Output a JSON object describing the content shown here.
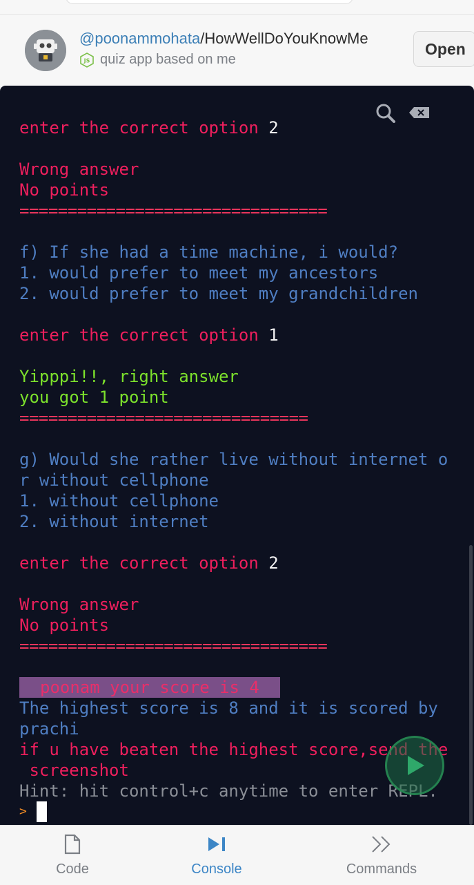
{
  "repl": {
    "owner": "@poonammohata",
    "separator": "/",
    "name": "HowWellDoYouKnowMe",
    "description": "quiz app based on me",
    "language_icon": "nodejs-icon",
    "open_label": "Open"
  },
  "console": {
    "lines": [
      {
        "parts": [
          {
            "t": "enter the correct option ",
            "c": "red"
          },
          {
            "t": "2",
            "c": "white"
          }
        ]
      },
      {
        "parts": []
      },
      {
        "parts": [
          {
            "t": "Wrong answer",
            "c": "red"
          }
        ]
      },
      {
        "parts": [
          {
            "t": "No points",
            "c": "red"
          }
        ]
      },
      {
        "parts": [
          {
            "t": "================================",
            "c": "sep"
          }
        ]
      },
      {
        "parts": []
      },
      {
        "parts": [
          {
            "t": "f) If she had a time machine, i would?",
            "c": "blue"
          }
        ]
      },
      {
        "parts": [
          {
            "t": "1. would prefer to meet my ancestors",
            "c": "blue"
          }
        ]
      },
      {
        "parts": [
          {
            "t": "2. would prefer to meet my grandchildren",
            "c": "blue"
          }
        ]
      },
      {
        "parts": []
      },
      {
        "parts": [
          {
            "t": "enter the correct option ",
            "c": "red"
          },
          {
            "t": "1",
            "c": "white"
          }
        ]
      },
      {
        "parts": []
      },
      {
        "parts": [
          {
            "t": "Yipppi!!, right answer",
            "c": "green"
          }
        ]
      },
      {
        "parts": [
          {
            "t": "you got 1 point",
            "c": "green"
          }
        ]
      },
      {
        "parts": [
          {
            "t": "==============================",
            "c": "sep"
          }
        ]
      },
      {
        "parts": []
      },
      {
        "parts": [
          {
            "t": "g) Would she rather live without internet o",
            "c": "blue"
          }
        ]
      },
      {
        "parts": [
          {
            "t": "r without cellphone",
            "c": "blue"
          }
        ]
      },
      {
        "parts": [
          {
            "t": "1. without cellphone",
            "c": "blue"
          }
        ]
      },
      {
        "parts": [
          {
            "t": "2. without internet",
            "c": "blue"
          }
        ]
      },
      {
        "parts": []
      },
      {
        "parts": [
          {
            "t": "enter the correct option ",
            "c": "red"
          },
          {
            "t": "2",
            "c": "white"
          }
        ]
      },
      {
        "parts": []
      },
      {
        "parts": [
          {
            "t": "Wrong answer",
            "c": "red"
          }
        ]
      },
      {
        "parts": [
          {
            "t": "No points",
            "c": "red"
          }
        ]
      },
      {
        "parts": [
          {
            "t": "================================",
            "c": "sep"
          }
        ]
      },
      {
        "parts": []
      },
      {
        "parts": [
          {
            "t": "poonam your score is 4",
            "c": "score"
          }
        ]
      },
      {
        "parts": [
          {
            "t": "The highest score is 8 and it is scored by",
            "c": "blue"
          }
        ]
      },
      {
        "parts": [
          {
            "t": "prachi",
            "c": "blue"
          }
        ]
      },
      {
        "parts": [
          {
            "t": "if u have beaten the highest score,send the",
            "c": "red"
          }
        ]
      },
      {
        "parts": [
          {
            "t": " screenshot",
            "c": "red"
          }
        ]
      },
      {
        "parts": [
          {
            "t": "Hint: hit control+c anytime to enter REPL.",
            "c": "grey"
          }
        ]
      }
    ],
    "prompt_symbol": ">"
  },
  "nav": {
    "items": [
      {
        "label": "Code",
        "icon": "file-icon",
        "active": false
      },
      {
        "label": "Console",
        "icon": "play-step-icon",
        "active": true
      },
      {
        "label": "Commands",
        "icon": "double-chevron-right-icon",
        "active": false
      }
    ]
  },
  "colors": {
    "console_bg": "#0d1120",
    "accent_blue": "#3d86c6",
    "term_red": "#ee1f5d",
    "term_blue": "#4f7ec2",
    "term_green": "#7ce12c"
  }
}
